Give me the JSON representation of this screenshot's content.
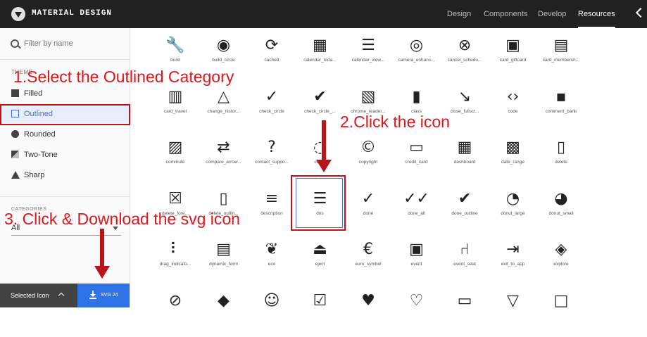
{
  "header": {
    "brand": "MATERIAL DESIGN",
    "nav": [
      {
        "label": "Design"
      },
      {
        "label": "Components"
      },
      {
        "label": "Develop"
      },
      {
        "label": "Resources",
        "active": true
      }
    ]
  },
  "sidebar": {
    "search_placeholder": "Filter by name",
    "theme_label": "THEME",
    "themes": [
      {
        "label": "Filled"
      },
      {
        "label": "Outlined",
        "selected": true
      },
      {
        "label": "Rounded"
      },
      {
        "label": "Two-Tone"
      },
      {
        "label": "Sharp"
      }
    ],
    "categories_label": "CATEGORIES",
    "category_value": "All"
  },
  "bottom_bar": {
    "selected_label": "Selected Icon",
    "download_label": "SVG 24"
  },
  "icons": [
    [
      "build",
      "build_circle",
      "cached",
      "calendar_toda...",
      "calendar_view...",
      "camera_enhanc...",
      "cancel_schedu...",
      "card_giftcard",
      "card_membersh..."
    ],
    [
      "card_travel",
      "change_histor...",
      "check_circle",
      "check_circle_...",
      "chrome_reader...",
      "class",
      "close_fullscr...",
      "code",
      "comment_bank"
    ],
    [
      "commute",
      "compare_arrow...",
      "contact_suppo...",
      "con...",
      "copyright",
      "credit_card",
      "dashboard",
      "date_range",
      "delete"
    ],
    [
      "delete_fore...",
      "delete_outlin...",
      "description",
      "dns",
      "done",
      "done_all",
      "done_outline",
      "donut_large",
      "donut_small"
    ],
    [
      "drag_indicato...",
      "dynamic_form",
      "eco",
      "eject",
      "euro_symbol",
      "event",
      "event_seat",
      "exit_to_app",
      "explore"
    ],
    [
      "",
      "",
      "",
      "",
      "",
      "",
      "",
      "",
      ""
    ]
  ],
  "selected_icon": "dns",
  "annotations": {
    "step1": "1.Select the Outlined Category",
    "step2": "2.Click the icon",
    "step3": "3. Click & Download the svg icon"
  },
  "colors": {
    "accent": "#2f73e8",
    "annotation_red": "#e0161c",
    "topbar": "#212121"
  }
}
